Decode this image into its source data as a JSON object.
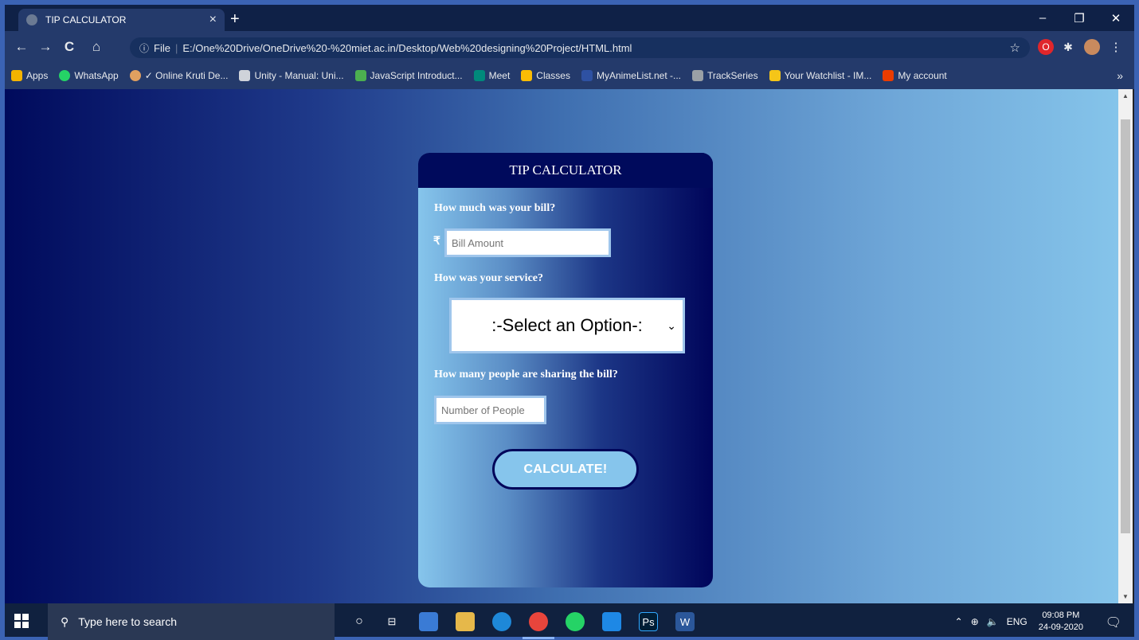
{
  "browser": {
    "tab_title": "TIP CALCULATOR",
    "tab_close": "×",
    "new_tab": "+",
    "url_prefix": "File",
    "url": "E:/One%20Drive/OneDrive%20-%20miet.ac.in/Desktop/Web%20designing%20Project/HTML.html",
    "window_controls": [
      "–",
      "❐",
      "✕"
    ]
  },
  "bookmarks": [
    {
      "label": "Apps",
      "color": "#f4b400"
    },
    {
      "label": "WhatsApp",
      "color": "#25d366"
    },
    {
      "label": "✓ Online Kruti De...",
      "color": "#e0a060"
    },
    {
      "label": "Unity - Manual: Uni...",
      "color": "#cfd3da"
    },
    {
      "label": "JavaScript Introduct...",
      "color": "#4caf50"
    },
    {
      "label": "Meet",
      "color": "#00897b"
    },
    {
      "label": "Classes",
      "color": "#fbbc04"
    },
    {
      "label": "MyAnimeList.net -...",
      "color": "#2e51a2"
    },
    {
      "label": "TrackSeries",
      "color": "#9aa0a6"
    },
    {
      "label": "Your Watchlist - IM...",
      "color": "#f5c518"
    },
    {
      "label": "My account",
      "color": "#eb3c00"
    }
  ],
  "bookmarks_more": "»",
  "app": {
    "title": "TIP CALCULATOR",
    "bill_question": "How much was your bill?",
    "currency_symbol": "₹",
    "bill_placeholder": "Bill Amount",
    "service_question": "How was your service?",
    "service_selected": ":-Select an Option-:",
    "people_question": "How many people are sharing the bill?",
    "people_placeholder": "Number of People",
    "calculate_label": "CALCULATE!"
  },
  "taskbar": {
    "search_placeholder": "Type here to search",
    "language": "ENG",
    "time": "09:08 PM",
    "date": "24-09-2020"
  },
  "colors": {
    "card_header": "#000a5c",
    "button_fill": "#86c5ec",
    "input_border": "#9fc6ec"
  }
}
